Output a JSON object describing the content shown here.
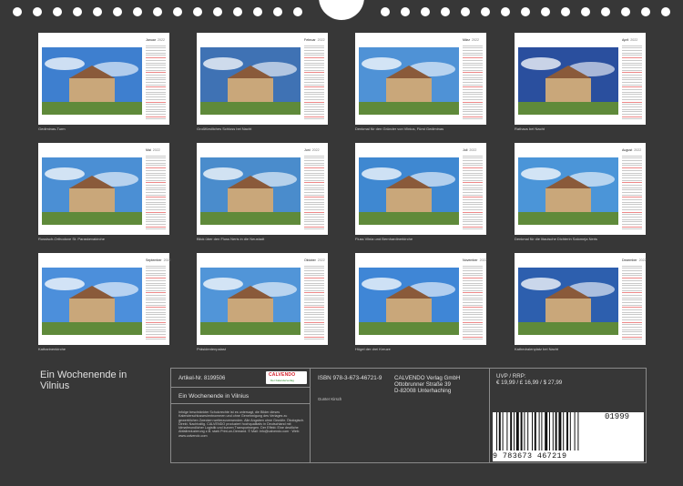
{
  "year": "2022",
  "months": [
    {
      "name": "Januar",
      "caption": "Gediminas-Turm",
      "sky": "#3e7fcf"
    },
    {
      "name": "Februar",
      "caption": "Großfürstliches Schloss bei Nacht",
      "sky": "#3f72b4"
    },
    {
      "name": "März",
      "caption": "Denkmal für den Gründer von Vilnius, Fürst Gediminas",
      "sky": "#4f92d6"
    },
    {
      "name": "April",
      "caption": "Rathaus bei Nacht",
      "sky": "#2a4f9e"
    },
    {
      "name": "Mai",
      "caption": "Russisch-Orthodoxe St. Paraskevakirche",
      "sky": "#4b8fd4"
    },
    {
      "name": "Juni",
      "caption": "Blick über den Fluss Neris in die Neustadt",
      "sky": "#4a8ccc"
    },
    {
      "name": "Juli",
      "caption": "Fluss Vilnia und Bernhardinerkirche",
      "sky": "#3f88d1"
    },
    {
      "name": "August",
      "caption": "Denkmal für die litauische Dichterin Salomeja Neris",
      "sky": "#4b95d8"
    },
    {
      "name": "September",
      "caption": "Katharinenkirche",
      "sky": "#4c8fdb"
    },
    {
      "name": "Oktober",
      "caption": "Präsidentenpalast",
      "sky": "#5195d8"
    },
    {
      "name": "November",
      "caption": "Hügel der drei Kreuze",
      "sky": "#3f86d6"
    },
    {
      "name": "Dezember",
      "caption": "Kathedralenplatz bei Nacht",
      "sky": "#2d5fae"
    }
  ],
  "footer": {
    "title": "Ein Wochenende in Vilnius",
    "article_label": "Artikel-Nr. 8199506",
    "logo_main": "CALVENDO",
    "logo_sub": "Der Kalenderverlag",
    "panel_title": "Ein Wochenende in Vilnius",
    "legal": "Infolge beschränkter Schutzrechte ist es untersagt, die Bilder dieses Kalenderschlusses/entnommen und ohne Genehmigung des Verlages zu gewerblichen Zwecken weiterzuverwenden. Alle Angaben ohne Gewähr. Ökologisch. Direkt. Nachhaltig. CALVENDO produziert hochqualitativ in Deutschland mit klimafreundlicher Logistik und kurzen Transportwegen. Der Effekt: Eine deutliche Abfallreduzierung z.B. stark Print-on-Demand. © Mail: info@calvendo.com · Web: www.calvendo.com",
    "isbn": "ISBN 978-3-673-46721-9",
    "author": "Gunter Kirsch",
    "publisher": [
      "CALVENDO Verlag GmbH",
      "Ottobrunner Straße 39",
      "D-82008 Unterhaching"
    ],
    "price": [
      "UVP / RRP:",
      "€ 19,99 / £ 16,99 / $ 27,99"
    ],
    "barcode_addon": "01999",
    "barcode_digits": "9 783673 467219"
  }
}
